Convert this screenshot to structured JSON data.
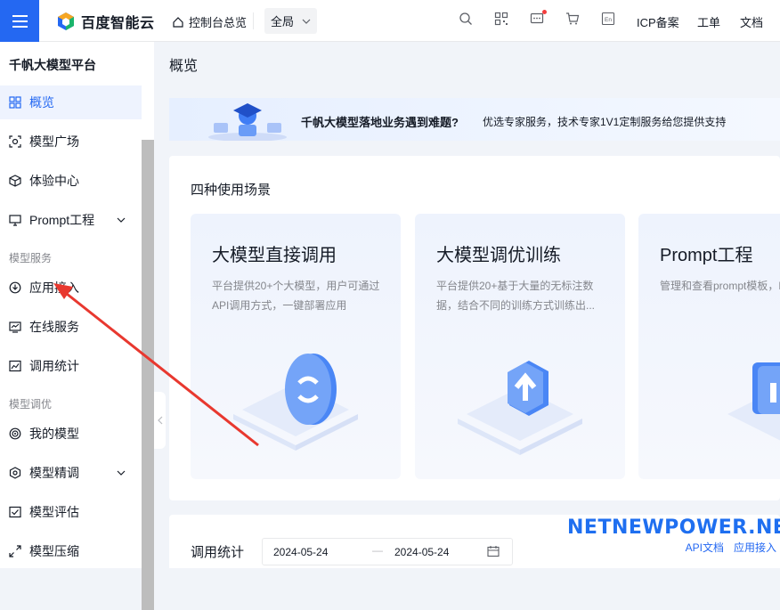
{
  "header": {
    "brand": "百度智能云",
    "console_link": "控制台总览",
    "scope_select": "全局",
    "icp_link": "ICP备案",
    "ticket_link": "工单",
    "docs_link": "文档",
    "lang_badge": "En"
  },
  "sidebar": {
    "title": "千帆大模型平台",
    "item_overview": "概览",
    "item_models": "模型广场",
    "item_experience": "体验中心",
    "item_prompt": "Prompt工程",
    "group_services": "模型服务",
    "item_app_access": "应用接入",
    "item_online": "在线服务",
    "item_stats": "调用统计",
    "group_tuning": "模型调优",
    "item_my_models": "我的模型",
    "item_finetune": "模型精调",
    "item_eval": "模型评估",
    "item_compress": "模型压缩"
  },
  "main": {
    "page_title": "概览",
    "banner": {
      "headline": "千帆大模型落地业务遇到难题?",
      "subtext": "优选专家服务，技术专家1V1定制服务给您提供支持"
    },
    "scenarios": {
      "title": "四种使用场景",
      "cards": [
        {
          "title": "大模型直接调用",
          "desc": "平台提供20+个大模型，用户可通过API调用方式，一键部署应用"
        },
        {
          "title": "大模型调优训练",
          "desc": "平台提供20+基于大量的无标注数据，结合不同的训练方式训练出..."
        },
        {
          "title": "Prompt工程",
          "desc": "管理和查看prompt模板，Prompt内容质量和结构上"
        }
      ]
    },
    "stats": {
      "title": "调用统计",
      "start_date": "2024-05-24",
      "separator": "—",
      "end_date": "2024-05-24",
      "api_docs_link": "API文档",
      "app_access_link": "应用接入"
    }
  },
  "watermark": "NETNEWPOWER.NET",
  "colors": {
    "accent": "#2468f2",
    "annotation_arrow": "#e8382f"
  }
}
